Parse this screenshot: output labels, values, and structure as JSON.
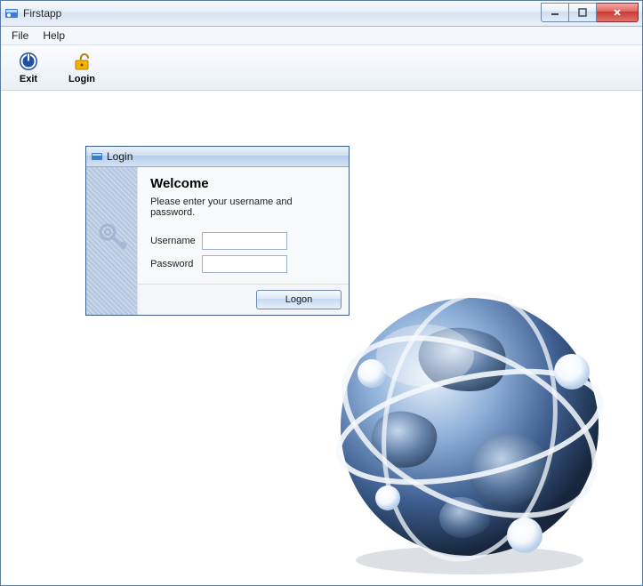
{
  "window": {
    "title": "Firstapp"
  },
  "menubar": {
    "file": "File",
    "help": "Help"
  },
  "toolbar": {
    "exit": "Exit",
    "login": "Login"
  },
  "dialog": {
    "title": "Login",
    "heading": "Welcome",
    "instruction": "Please enter your username and password.",
    "username_label": "Username",
    "password_label": "Password",
    "username_value": "",
    "password_value": "",
    "logon_button": "Logon"
  }
}
